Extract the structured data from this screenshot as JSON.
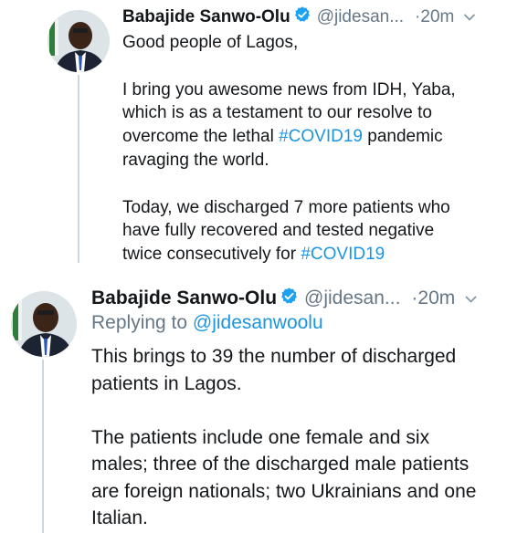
{
  "tweets": [
    {
      "author_name": "Babajide Sanwo-Olu",
      "handle": "@jidesan...",
      "time_sep": " ·",
      "time": "20m",
      "body": [
        {
          "t": "Good people of Lagos,\n\nI bring you awesome news from IDH, Yaba,\nwhich is as a testament to our resolve to\novercome the lethal "
        },
        {
          "t": "#COVID19",
          "tag": true
        },
        {
          "t": " pandemic\nravaging the world.\n\nToday, we discharged 7 more patients who\nhave fully recovered and tested negative\ntwice consecutively for "
        },
        {
          "t": "#COVID19",
          "tag": true
        }
      ]
    },
    {
      "author_name": "Babajide Sanwo-Olu",
      "handle": "@jidesan...",
      "time_sep": " ·",
      "time": "20m",
      "replying_label": "Replying to ",
      "replying_to": "@jidesanwoolu",
      "body": [
        {
          "t": "This brings to 39 the number of discharged\npatients in Lagos.\n\nThe patients include one female and six\nmales; three of the discharged male patients\nare foreign nationals; two Ukrainians and one\nItalian."
        }
      ]
    }
  ],
  "icons": {
    "verified": "verified-badge-icon",
    "more": "chevron-down-icon"
  },
  "colors": {
    "link": "#1b95e0",
    "muted": "#657786",
    "verified": "#1da1f2",
    "thread_line": "#ccd6dd"
  }
}
